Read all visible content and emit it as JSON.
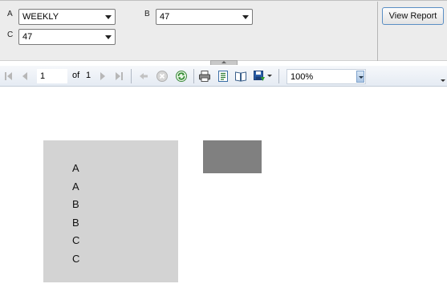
{
  "params": {
    "a": {
      "label": "A",
      "value": "WEEKLY"
    },
    "b": {
      "label": "B",
      "value": "47"
    },
    "c": {
      "label": "C",
      "value": "47"
    },
    "view_report_label": "View Report"
  },
  "toolbar": {
    "page_current": "1",
    "of_label": "of",
    "page_total": "1",
    "zoom": "100%",
    "icons": [
      "first-page-icon",
      "prev-page-icon",
      "next-page-icon",
      "last-page-icon",
      "back-icon",
      "stop-icon",
      "refresh-icon",
      "print-icon",
      "print-layout-icon",
      "page-setup-icon",
      "export-icon"
    ]
  },
  "report": {
    "list_items": [
      "A",
      "A",
      "B",
      "B",
      "C",
      "C"
    ]
  },
  "colors": {
    "param_bg": "#ececec",
    "list_box_bg": "#d3d3d3",
    "gray_box": "#808080",
    "button_border": "#5a8ec4"
  }
}
